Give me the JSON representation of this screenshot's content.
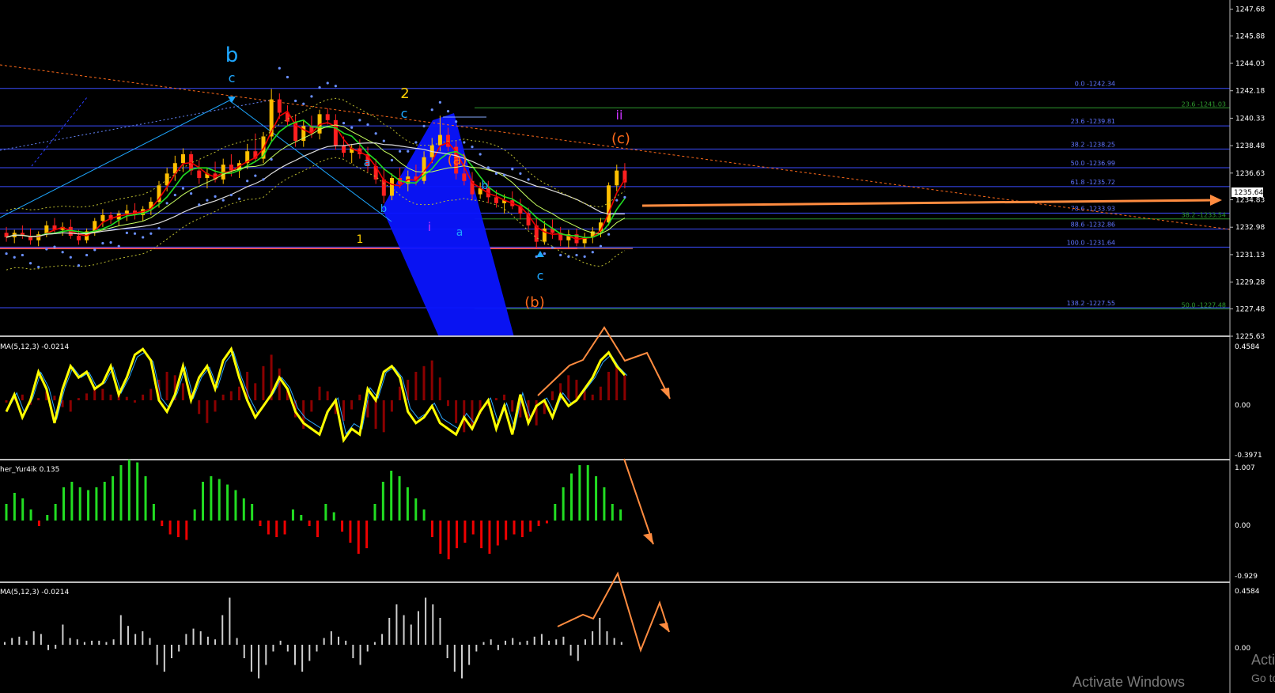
{
  "colors": {
    "background": "#000000",
    "bull_candle": "#ffc000",
    "bear_candle": "#ff2020",
    "fib_line": "#3b4dff",
    "fib_text": "#5f74ff",
    "fib_green": "#2e9a2e",
    "hist_dark_red": "#8b0000",
    "stoch_yellow": "#ffff00",
    "lime": "#22dd22",
    "red": "#ee0000",
    "gray_hist": "#cfcfcf",
    "arrow_orange": "#ff8c40",
    "wave_cyan": "#1ea7ff",
    "wave_orange": "#ff6a1a",
    "wave_yellow": "#ffd000",
    "wave_magenta": "#cc33ff",
    "blue_wedge": "#0a14ff"
  },
  "price_axis": {
    "ticks": [
      "1247.68",
      "1245.88",
      "1244.03",
      "1242.18",
      "1240.33",
      "1238.48",
      "1236.63",
      "1235.64",
      "1234.83",
      "1232.98",
      "1231.13",
      "1229.28",
      "1227.48",
      "1225.63"
    ],
    "current_price": "1235.64",
    "ylim": [
      1225.63,
      1248.3
    ]
  },
  "fib_levels": [
    {
      "label": "0.0 -1242.34",
      "value": 1242.34
    },
    {
      "label": "23.6 -1239.81",
      "value": 1239.81
    },
    {
      "label": "38.2 -1238.25",
      "value": 1238.25
    },
    {
      "label": "50.0 -1236.99",
      "value": 1236.99
    },
    {
      "label": "61.8 -1235.72",
      "value": 1235.72
    },
    {
      "label": "78.6 -1233.93",
      "value": 1233.93
    },
    {
      "label": "88.6 -1232.86",
      "value": 1232.86
    },
    {
      "label": "100.0 -1231.64",
      "value": 1231.64
    },
    {
      "label": "138.2 -1227.55",
      "value": 1227.55
    }
  ],
  "fib_levels_green": [
    {
      "label": "23.6 -1241.03",
      "value": 1241.03
    },
    {
      "label": "38.2 -1233.54",
      "value": 1233.54
    },
    {
      "label": "50.0 -1227.48",
      "value": 1227.48
    }
  ],
  "wave_labels": [
    {
      "text": "b",
      "color": "#1ea7ff",
      "big": true
    },
    {
      "text": "c",
      "color": "#1ea7ff"
    },
    {
      "text": "2",
      "color": "#ffd000"
    },
    {
      "text": "c",
      "color": "#1ea7ff"
    },
    {
      "text": "(a)",
      "color": "#ff6a1a"
    },
    {
      "text": "a",
      "color": "#1ea7ff"
    },
    {
      "text": "b",
      "color": "#1ea7ff"
    },
    {
      "text": "1",
      "color": "#ffd000"
    },
    {
      "text": "i",
      "color": "#cc33ff"
    },
    {
      "text": "a",
      "color": "#1ea7ff"
    },
    {
      "text": "b",
      "color": "#1ea7ff"
    },
    {
      "text": "c",
      "color": "#1ea7ff"
    },
    {
      "text": "(b)",
      "color": "#ff6a1a"
    },
    {
      "text": "ii",
      "color": "#cc33ff"
    },
    {
      "text": "(c)",
      "color": "#ff6a1a"
    }
  ],
  "indicators": [
    {
      "label": "MA(5,12,3) -0.0214",
      "axis": [
        "0.4584",
        "0.00",
        "-0.3971"
      ]
    },
    {
      "label": "her_Yur4ik 0.135",
      "axis": [
        "1.007",
        "0.00",
        "-0.929"
      ]
    },
    {
      "label": "MA(5,12,3) -0.0214",
      "axis": [
        "0.4584",
        "0.00"
      ]
    }
  ],
  "chart_data": {
    "type": "candlestick",
    "ylim": [
      1225.63,
      1248.3
    ],
    "current_price": 1235.64,
    "candles": [
      [
        1232.6,
        1233.0,
        1232.0,
        1232.3
      ],
      [
        1232.3,
        1232.8,
        1231.9,
        1232.6
      ],
      [
        1232.6,
        1233.1,
        1232.2,
        1232.4
      ],
      [
        1232.4,
        1232.9,
        1231.8,
        1232.1
      ],
      [
        1232.1,
        1232.7,
        1231.7,
        1232.5
      ],
      [
        1232.5,
        1233.4,
        1232.3,
        1233.1
      ],
      [
        1233.1,
        1233.6,
        1232.6,
        1232.8
      ],
      [
        1232.8,
        1233.3,
        1232.4,
        1233.0
      ],
      [
        1233.0,
        1233.5,
        1232.2,
        1232.4
      ],
      [
        1232.4,
        1232.8,
        1231.8,
        1232.1
      ],
      [
        1232.1,
        1232.9,
        1231.9,
        1232.7
      ],
      [
        1232.7,
        1233.6,
        1232.4,
        1233.4
      ],
      [
        1233.4,
        1234.2,
        1233.0,
        1233.8
      ],
      [
        1233.8,
        1234.0,
        1233.2,
        1233.5
      ],
      [
        1233.5,
        1234.1,
        1233.1,
        1233.9
      ],
      [
        1233.9,
        1234.5,
        1233.4,
        1234.1
      ],
      [
        1234.1,
        1234.6,
        1233.5,
        1233.8
      ],
      [
        1233.8,
        1234.4,
        1233.4,
        1234.2
      ],
      [
        1234.2,
        1235.0,
        1233.8,
        1234.7
      ],
      [
        1234.7,
        1236.1,
        1234.3,
        1235.8
      ],
      [
        1235.8,
        1237.0,
        1235.4,
        1236.6
      ],
      [
        1236.6,
        1237.8,
        1236.1,
        1237.3
      ],
      [
        1237.3,
        1238.3,
        1236.7,
        1237.9
      ],
      [
        1237.9,
        1238.1,
        1236.5,
        1236.8
      ],
      [
        1236.8,
        1237.5,
        1235.9,
        1236.3
      ],
      [
        1236.3,
        1237.0,
        1235.6,
        1236.6
      ],
      [
        1236.6,
        1237.4,
        1236.0,
        1236.2
      ],
      [
        1236.2,
        1237.6,
        1235.9,
        1237.2
      ],
      [
        1237.2,
        1237.9,
        1236.4,
        1236.8
      ],
      [
        1236.8,
        1237.5,
        1236.3,
        1237.3
      ],
      [
        1237.3,
        1238.6,
        1236.9,
        1238.1
      ],
      [
        1238.1,
        1239.3,
        1237.4,
        1237.6
      ],
      [
        1237.6,
        1239.4,
        1237.3,
        1239.1
      ],
      [
        1239.1,
        1242.3,
        1238.8,
        1241.6
      ],
      [
        1241.6,
        1242.0,
        1240.3,
        1240.7
      ],
      [
        1240.7,
        1241.2,
        1239.8,
        1240.1
      ],
      [
        1240.1,
        1240.6,
        1238.4,
        1238.8
      ],
      [
        1238.8,
        1240.2,
        1238.4,
        1239.8
      ],
      [
        1239.8,
        1240.5,
        1239.0,
        1239.3
      ],
      [
        1239.3,
        1240.9,
        1238.9,
        1240.6
      ],
      [
        1240.6,
        1241.0,
        1239.9,
        1240.2
      ],
      [
        1240.2,
        1240.6,
        1238.2,
        1238.5
      ],
      [
        1238.5,
        1239.1,
        1237.7,
        1238.0
      ],
      [
        1238.0,
        1238.6,
        1237.3,
        1238.3
      ],
      [
        1238.3,
        1238.9,
        1237.6,
        1237.9
      ],
      [
        1237.9,
        1238.4,
        1236.7,
        1237.1
      ],
      [
        1237.1,
        1237.6,
        1235.9,
        1236.2
      ],
      [
        1236.2,
        1236.9,
        1234.6,
        1235.1
      ],
      [
        1235.1,
        1236.6,
        1234.8,
        1236.3
      ],
      [
        1236.3,
        1237.0,
        1235.6,
        1235.9
      ],
      [
        1235.9,
        1236.8,
        1235.4,
        1236.4
      ],
      [
        1236.4,
        1237.2,
        1235.8,
        1236.1
      ],
      [
        1236.1,
        1238.1,
        1235.9,
        1237.7
      ],
      [
        1237.7,
        1239.0,
        1237.3,
        1238.5
      ],
      [
        1238.5,
        1240.5,
        1238.1,
        1239.2
      ],
      [
        1239.2,
        1239.7,
        1238.1,
        1238.4
      ],
      [
        1238.4,
        1238.8,
        1236.2,
        1236.6
      ],
      [
        1236.6,
        1237.2,
        1235.8,
        1236.1
      ],
      [
        1236.1,
        1236.7,
        1234.8,
        1235.2
      ],
      [
        1235.2,
        1236.0,
        1234.9,
        1235.6
      ],
      [
        1235.6,
        1236.1,
        1234.6,
        1235.0
      ],
      [
        1235.0,
        1235.5,
        1234.3,
        1234.6
      ],
      [
        1234.6,
        1235.2,
        1233.9,
        1234.8
      ],
      [
        1234.8,
        1235.4,
        1234.2,
        1234.4
      ],
      [
        1234.4,
        1234.9,
        1233.5,
        1233.9
      ],
      [
        1233.9,
        1234.3,
        1232.8,
        1233.1
      ],
      [
        1233.1,
        1233.6,
        1231.6,
        1232.0
      ],
      [
        1232.0,
        1233.4,
        1231.8,
        1232.9
      ],
      [
        1232.9,
        1233.5,
        1232.2,
        1232.6
      ],
      [
        1232.6,
        1233.0,
        1231.7,
        1232.1
      ],
      [
        1232.1,
        1232.8,
        1231.6,
        1232.5
      ],
      [
        1232.5,
        1232.9,
        1231.7,
        1231.9
      ],
      [
        1231.9,
        1232.6,
        1231.6,
        1232.3
      ],
      [
        1232.3,
        1233.0,
        1231.9,
        1232.7
      ],
      [
        1232.7,
        1233.6,
        1232.3,
        1233.3
      ],
      [
        1233.3,
        1236.0,
        1233.1,
        1235.8
      ],
      [
        1235.8,
        1237.2,
        1235.4,
        1236.8
      ],
      [
        1236.8,
        1237.3,
        1235.6,
        1236.0
      ]
    ],
    "indicator1": {
      "hist": [
        -0.02,
        0.03,
        0.05,
        -0.04,
        0.02,
        0.08,
        0.04,
        -0.06,
        -0.1,
        0.02,
        0.06,
        0.12,
        0.1,
        0.05,
        0.07,
        0.03,
        -0.02,
        0.05,
        0.1,
        0.18,
        0.25,
        0.22,
        0.15,
        0.06,
        -0.12,
        -0.2,
        -0.1,
        0.05,
        0.08,
        0.12,
        0.25,
        0.15,
        0.3,
        0.4,
        0.28,
        0.1,
        -0.15,
        -0.25,
        -0.1,
        0.12,
        0.08,
        -0.12,
        -0.18,
        -0.08,
        0.05,
        -0.15,
        -0.25,
        -0.28,
        -0.1,
        0.12,
        0.18,
        0.25,
        0.3,
        0.35,
        0.2,
        -0.05,
        -0.2,
        -0.28,
        -0.22,
        -0.12,
        -0.05,
        0.02,
        0.05,
        -0.1,
        -0.15,
        -0.2,
        -0.22,
        -0.12,
        0.08,
        0.15,
        0.22,
        0.18,
        0.1,
        0.05,
        0.12,
        0.25,
        0.3,
        0.22
      ],
      "stoch": [
        -0.1,
        0.05,
        -0.15,
        0.0,
        0.25,
        0.1,
        -0.2,
        0.1,
        0.3,
        0.2,
        0.25,
        0.1,
        0.15,
        0.3,
        0.05,
        0.2,
        0.4,
        0.45,
        0.35,
        0.0,
        -0.1,
        0.05,
        0.3,
        0.0,
        0.2,
        0.3,
        0.1,
        0.35,
        0.45,
        0.2,
        0.0,
        -0.15,
        -0.05,
        0.05,
        0.2,
        0.1,
        -0.1,
        -0.2,
        -0.25,
        -0.3,
        -0.1,
        0.0,
        -0.35,
        -0.25,
        -0.3,
        0.1,
        0.0,
        0.25,
        0.3,
        0.2,
        -0.1,
        -0.2,
        -0.15,
        -0.05,
        -0.2,
        -0.25,
        -0.3,
        -0.15,
        -0.25,
        -0.1,
        0.0,
        -0.25,
        -0.05,
        -0.3,
        0.05,
        -0.2,
        -0.05,
        0.0,
        -0.15,
        0.05,
        -0.05,
        0.0,
        0.1,
        0.2,
        0.35,
        0.42,
        0.3,
        0.22
      ]
    },
    "indicator2": {
      "hist": [
        0.3,
        0.5,
        0.4,
        0.2,
        -0.1,
        0.1,
        0.3,
        0.6,
        0.7,
        0.6,
        0.55,
        0.6,
        0.7,
        0.8,
        1.0,
        1.1,
        1.05,
        0.8,
        0.3,
        -0.1,
        -0.25,
        -0.3,
        -0.35,
        0.2,
        0.7,
        0.8,
        0.75,
        0.65,
        0.55,
        0.4,
        0.3,
        -0.1,
        -0.25,
        -0.3,
        -0.25,
        0.2,
        0.1,
        -0.1,
        -0.3,
        0.3,
        0.15,
        -0.2,
        -0.4,
        -0.6,
        -0.5,
        0.3,
        0.7,
        0.9,
        0.8,
        0.6,
        0.4,
        0.2,
        -0.3,
        -0.6,
        -0.7,
        -0.5,
        -0.4,
        -0.25,
        -0.5,
        -0.6,
        -0.45,
        -0.35,
        -0.25,
        -0.3,
        -0.2,
        -0.1,
        -0.05,
        0.3,
        0.6,
        0.85,
        1.0,
        1.0,
        0.8,
        0.6,
        0.3,
        0.2
      ]
    },
    "indicator3": {
      "hist": [
        0.02,
        0.05,
        0.06,
        0.03,
        0.1,
        0.08,
        -0.04,
        -0.03,
        0.15,
        0.05,
        0.04,
        0.02,
        0.03,
        0.03,
        0.02,
        0.04,
        0.22,
        0.14,
        0.08,
        0.1,
        0.05,
        -0.15,
        -0.2,
        -0.1,
        -0.05,
        0.08,
        0.12,
        0.1,
        0.06,
        0.04,
        0.22,
        0.35,
        0.05,
        -0.1,
        -0.2,
        -0.25,
        -0.15,
        -0.05,
        0.03,
        -0.05,
        -0.15,
        -0.2,
        -0.12,
        -0.05,
        0.05,
        0.1,
        0.06,
        0.03,
        -0.1,
        -0.15,
        -0.05,
        0.02,
        0.08,
        0.2,
        0.3,
        0.22,
        0.15,
        0.25,
        0.35,
        0.3,
        0.2,
        -0.1,
        -0.2,
        -0.25,
        -0.15,
        -0.05,
        0.02,
        0.04,
        -0.04,
        0.03,
        0.05,
        0.02,
        0.03,
        0.06,
        0.08,
        0.03,
        0.04,
        0.06,
        -0.08,
        -0.12,
        0.04,
        0.1,
        0.2,
        0.1,
        0.05,
        0.02
      ]
    }
  },
  "watermark": {
    "title": "Activate Windows",
    "subtitle": "Acti",
    "subtitle2": "Go to"
  }
}
